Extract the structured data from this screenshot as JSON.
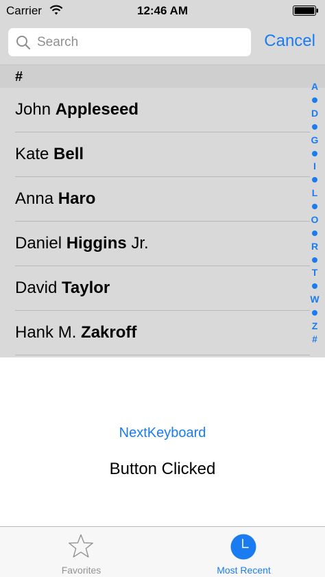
{
  "status_bar": {
    "carrier": "Carrier",
    "time": "12:46 AM"
  },
  "search": {
    "placeholder": "Search",
    "cancel_label": "Cancel"
  },
  "list": {
    "section_header": "#",
    "contacts": [
      {
        "first": "John",
        "last": "Appleseed",
        "suffix": ""
      },
      {
        "first": "Kate",
        "last": "Bell",
        "suffix": ""
      },
      {
        "first": "Anna",
        "last": "Haro",
        "suffix": ""
      },
      {
        "first": "Daniel",
        "last": "Higgins",
        "suffix": "Jr."
      },
      {
        "first": "David",
        "last": "Taylor",
        "suffix": ""
      },
      {
        "first": "Hank M.",
        "last": "Zakroff",
        "suffix": ""
      }
    ],
    "index": [
      "A",
      "•",
      "D",
      "•",
      "G",
      "•",
      "I",
      "•",
      "L",
      "•",
      "O",
      "•",
      "R",
      "•",
      "T",
      "•",
      "W",
      "•",
      "Z",
      "#"
    ]
  },
  "content": {
    "next_keyboard_label": "NextKeyboard",
    "status_message": "Button Clicked"
  },
  "tab_bar": {
    "tabs": [
      {
        "label": "Favorites",
        "icon": "star-icon",
        "selected": false
      },
      {
        "label": "Most Recent",
        "icon": "clock-icon",
        "selected": true
      }
    ]
  },
  "colors": {
    "accent": "#1a7cf0",
    "header_background": "#d9d9d9",
    "section_background": "#cfcfcf",
    "tab_inactive": "#929292"
  }
}
